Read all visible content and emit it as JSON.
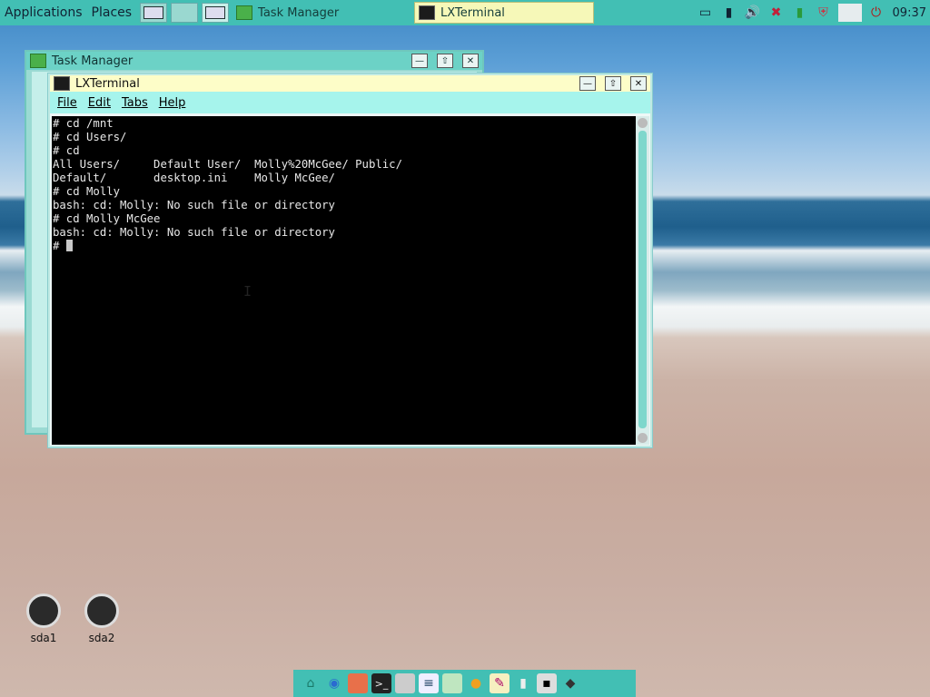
{
  "panel": {
    "applications_label": "Applications",
    "places_label": "Places",
    "tasks": [
      {
        "label": "Task Manager"
      },
      {
        "label": "LXTerminal"
      }
    ],
    "clock": "09:37",
    "tray_icons": [
      "folder-icon",
      "battery-icon",
      "volume-icon",
      "network-icon",
      "storage-icon",
      "shield-icon",
      "window-icon",
      "power-icon"
    ]
  },
  "taskmanager": {
    "title": "Task Manager"
  },
  "terminal": {
    "title": "LXTerminal",
    "menu": {
      "file": "File",
      "edit": "Edit",
      "tabs": "Tabs",
      "help": "Help"
    },
    "lines": [
      "# cd /mnt",
      "# cd Users/",
      "# cd",
      "All Users/     Default User/  Molly%20McGee/ Public/",
      "Default/       desktop.ini    Molly McGee/",
      "# cd Molly",
      "bash: cd: Molly: No such file or directory",
      "# cd Molly McGee",
      "bash: cd: Molly: No such file or directory",
      "# "
    ]
  },
  "desktop": {
    "icons": [
      {
        "label": "sda1"
      },
      {
        "label": "sda2"
      }
    ]
  },
  "dock": {
    "icons": [
      "home-icon",
      "globe-icon",
      "folder-icon",
      "terminal-icon",
      "files-icon",
      "document-icon",
      "notes-icon",
      "paint-icon",
      "editor-icon",
      "tools-icon",
      "monitor-icon",
      "settings-icon"
    ]
  }
}
